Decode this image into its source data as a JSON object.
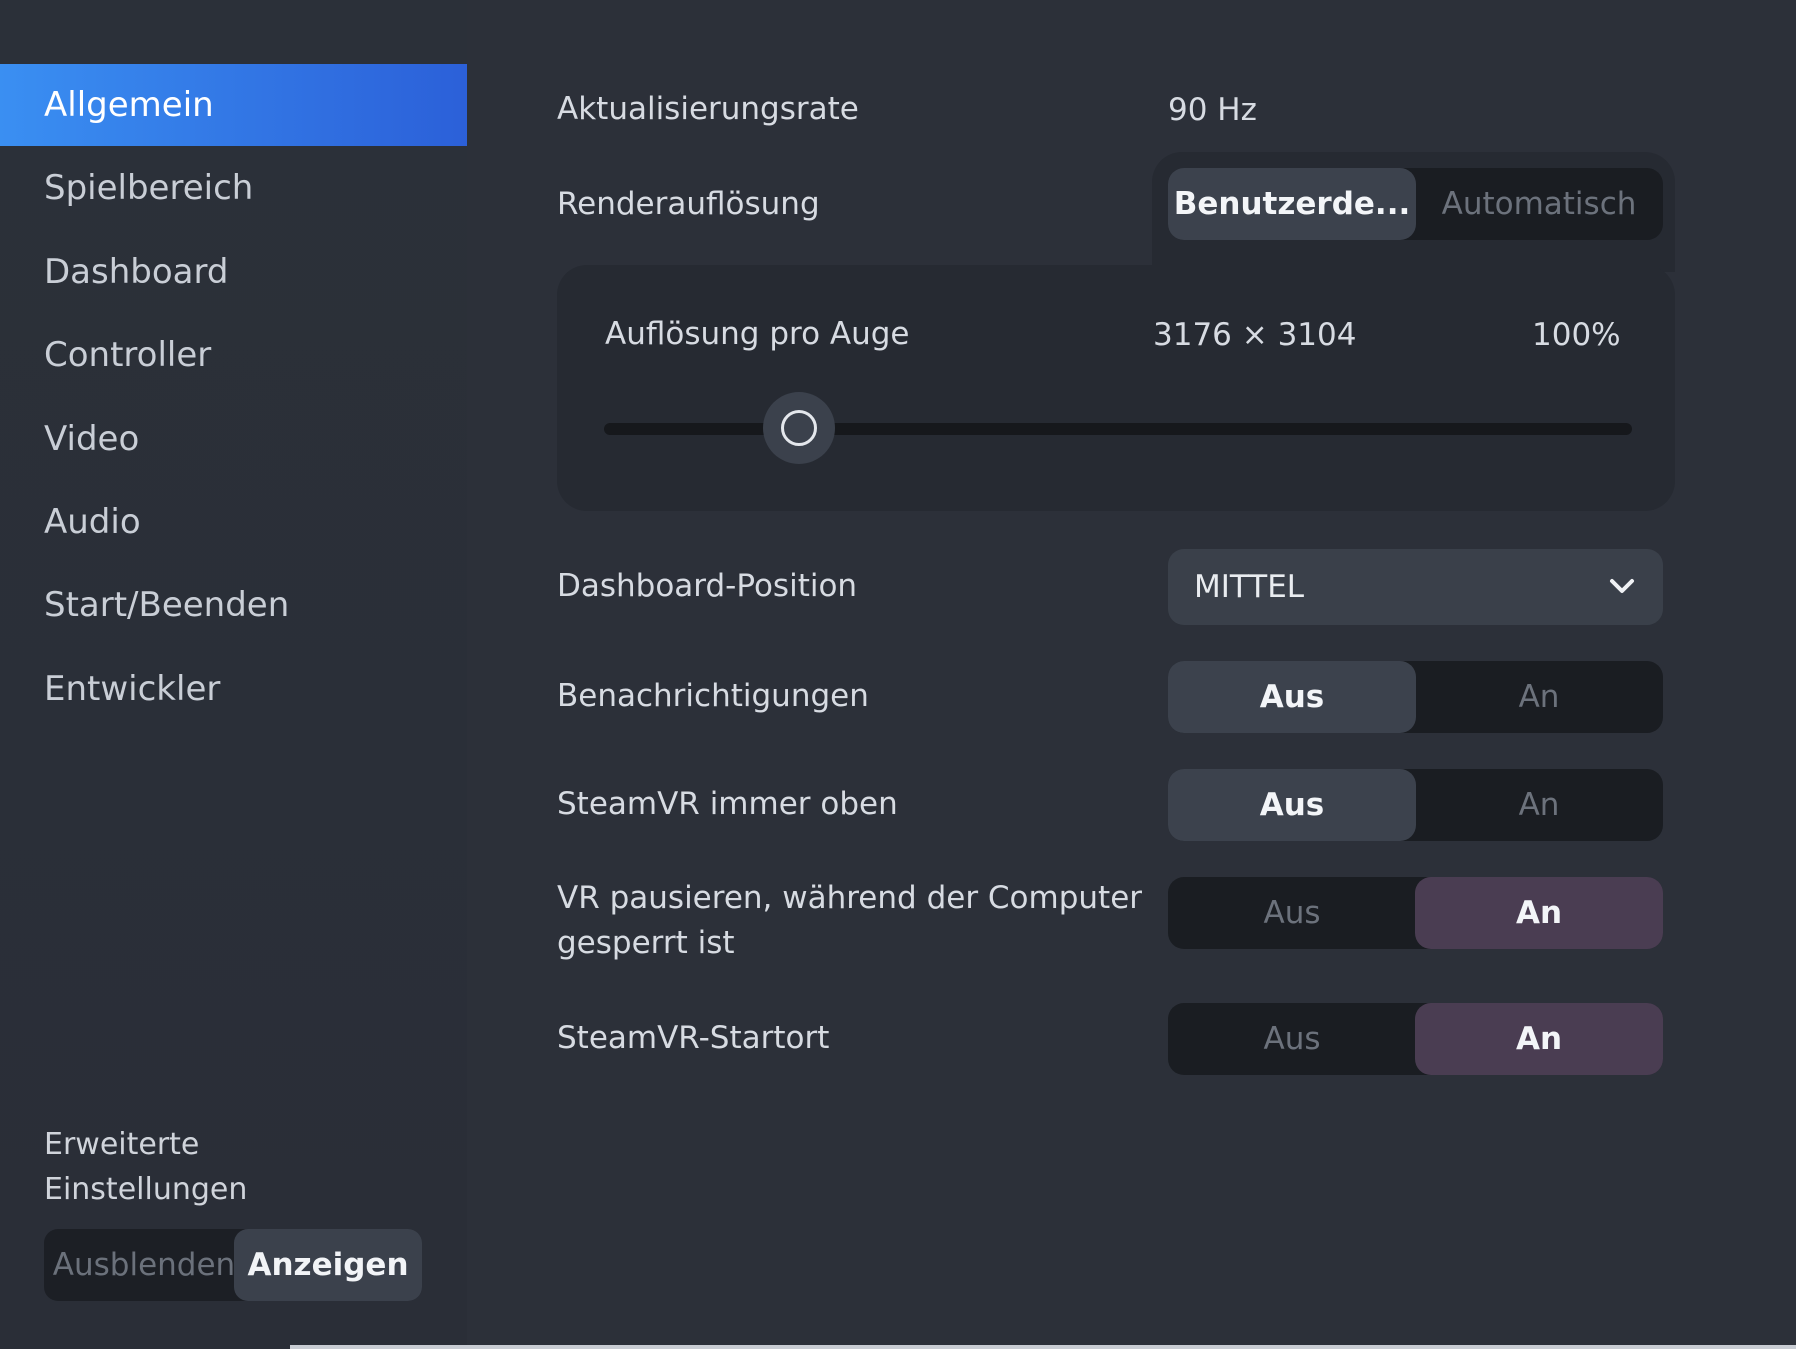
{
  "sidebar": {
    "items": [
      {
        "label": "Allgemein",
        "active": true
      },
      {
        "label": "Spielbereich"
      },
      {
        "label": "Dashboard"
      },
      {
        "label": "Controller"
      },
      {
        "label": "Video"
      },
      {
        "label": "Audio"
      },
      {
        "label": "Start/Beenden"
      },
      {
        "label": "Entwickler"
      }
    ],
    "advanced": {
      "label_line1": "Erweiterte",
      "label_line2": "Einstellungen",
      "off_label": "Ausblenden",
      "on_label": "Anzeigen",
      "selected": "Anzeigen"
    }
  },
  "settings": {
    "refresh": {
      "label": "Aktualisierungsrate",
      "value": "90 Hz"
    },
    "render": {
      "label": "Renderauflösung",
      "option_left": "Benutzerde...",
      "option_right": "Automatisch",
      "selected": "Benutzerde...",
      "per_eye": {
        "label": "Auflösung pro Auge",
        "resolution": "3176 × 3104",
        "percent": "100%",
        "slider_fraction": 0.19
      }
    },
    "dashboard_position": {
      "label": "Dashboard-Position",
      "value": "MITTEL",
      "icon": "chevron-down-icon"
    },
    "notifications": {
      "label": "Benachrichtigungen",
      "off": "Aus",
      "on": "An",
      "selected": "Aus"
    },
    "always_on_top": {
      "label": "SteamVR immer oben",
      "off": "Aus",
      "on": "An",
      "selected": "Aus"
    },
    "pause_locked": {
      "label_line1": "VR pausieren, während der Computer",
      "label_line2": "gesperrt ist",
      "off": "Aus",
      "on": "An",
      "selected": "An"
    },
    "home": {
      "label": "SteamVR-Startort",
      "off": "Aus",
      "on": "An",
      "selected": "An"
    }
  },
  "colors": {
    "accent_blue": "#3a8ff2",
    "selected_purple": "#4a3d52",
    "selected_grey": "#3c424d"
  }
}
